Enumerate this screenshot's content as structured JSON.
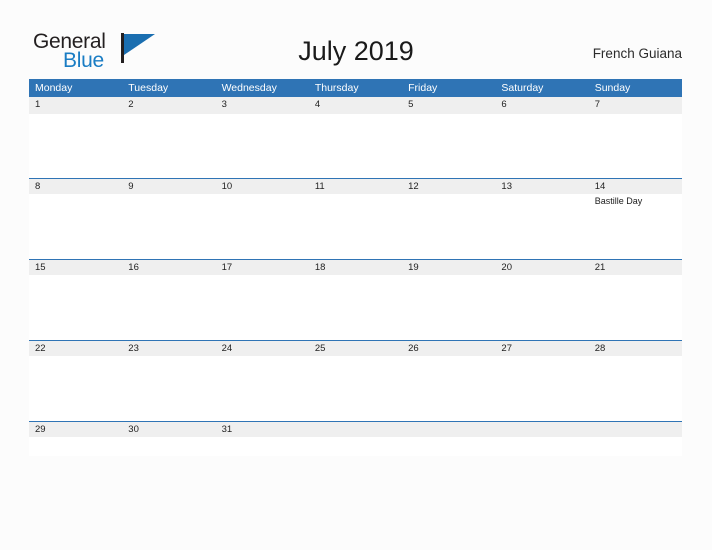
{
  "brand": {
    "name_part1": "General",
    "name_part2": "Blue",
    "flag_icon": "flag-icon",
    "color_dark": "#231f20",
    "color_blue": "#1a7dc4"
  },
  "header": {
    "title": "July 2019",
    "locale": "French Guiana"
  },
  "calendar": {
    "accent_color": "#2f74b5",
    "band_color": "#efefef",
    "weekdays": [
      "Monday",
      "Tuesday",
      "Wednesday",
      "Thursday",
      "Friday",
      "Saturday",
      "Sunday"
    ],
    "weeks": [
      {
        "days": [
          {
            "date": "1",
            "event": ""
          },
          {
            "date": "2",
            "event": ""
          },
          {
            "date": "3",
            "event": ""
          },
          {
            "date": "4",
            "event": ""
          },
          {
            "date": "5",
            "event": ""
          },
          {
            "date": "6",
            "event": ""
          },
          {
            "date": "7",
            "event": ""
          }
        ]
      },
      {
        "days": [
          {
            "date": "8",
            "event": ""
          },
          {
            "date": "9",
            "event": ""
          },
          {
            "date": "10",
            "event": ""
          },
          {
            "date": "11",
            "event": ""
          },
          {
            "date": "12",
            "event": ""
          },
          {
            "date": "13",
            "event": ""
          },
          {
            "date": "14",
            "event": "Bastille Day"
          }
        ]
      },
      {
        "days": [
          {
            "date": "15",
            "event": ""
          },
          {
            "date": "16",
            "event": ""
          },
          {
            "date": "17",
            "event": ""
          },
          {
            "date": "18",
            "event": ""
          },
          {
            "date": "19",
            "event": ""
          },
          {
            "date": "20",
            "event": ""
          },
          {
            "date": "21",
            "event": ""
          }
        ]
      },
      {
        "days": [
          {
            "date": "22",
            "event": ""
          },
          {
            "date": "23",
            "event": ""
          },
          {
            "date": "24",
            "event": ""
          },
          {
            "date": "25",
            "event": ""
          },
          {
            "date": "26",
            "event": ""
          },
          {
            "date": "27",
            "event": ""
          },
          {
            "date": "28",
            "event": ""
          }
        ]
      },
      {
        "days": [
          {
            "date": "29",
            "event": ""
          },
          {
            "date": "30",
            "event": ""
          },
          {
            "date": "31",
            "event": ""
          },
          {
            "date": "",
            "event": ""
          },
          {
            "date": "",
            "event": ""
          },
          {
            "date": "",
            "event": ""
          },
          {
            "date": "",
            "event": ""
          }
        ]
      }
    ]
  }
}
